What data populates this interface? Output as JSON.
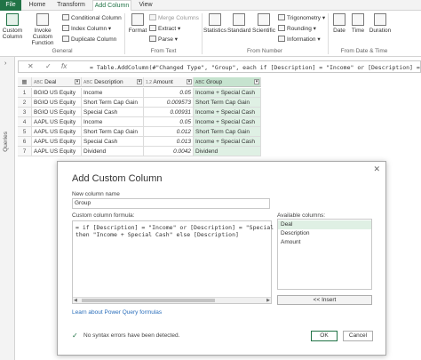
{
  "ribbon": {
    "tabs": [
      "File",
      "Home",
      "Transform",
      "Add Column",
      "View"
    ],
    "active_tab": "Add Column",
    "groups": {
      "general": {
        "label": "General",
        "custom_column": "Custom Column",
        "invoke_custom_function": "Invoke Custom Function",
        "conditional_column": "Conditional Column",
        "index_column": "Index Column",
        "duplicate_column": "Duplicate Column"
      },
      "from_text": {
        "label": "From Text",
        "format": "Format",
        "merge_columns": "Merge Columns",
        "extract": "Extract",
        "parse": "Parse"
      },
      "from_number": {
        "label": "From Number",
        "statistics": "Statistics",
        "standard": "Standard",
        "scientific": "Scientific",
        "trigonometry": "Trigonometry",
        "rounding": "Rounding",
        "information": "Information"
      },
      "from_date_time": {
        "label": "From Date & Time",
        "date": "Date",
        "time": "Time",
        "duration": "Duration"
      }
    }
  },
  "queries_pane": {
    "label": "Queries"
  },
  "formula_bar": {
    "cancel": "✕",
    "confirm": "✓",
    "fx": "fx",
    "text": "= Table.AddColumn(#\"Changed Type\", \"Group\", each if [Description] = \"Income\" or [Description] = \"Special Cash\""
  },
  "grid": {
    "headers": [
      "Deal",
      "Description",
      "Amount",
      "Group"
    ],
    "header_types": [
      "ABC",
      "ABC",
      "1.2",
      "ABC"
    ],
    "rows": [
      {
        "n": "1",
        "deal": "BGIO US Equity",
        "desc": "Income",
        "amount": "0.05",
        "group": "Income + Special Cash"
      },
      {
        "n": "2",
        "deal": "BGIO US Equity",
        "desc": "Short Term Cap Gain",
        "amount": "0.009573",
        "group": "Short Term Cap Gain"
      },
      {
        "n": "3",
        "deal": "BGIO US Equity",
        "desc": "Special Cash",
        "amount": "0.00931",
        "group": "Income + Special Cash"
      },
      {
        "n": "4",
        "deal": "AAPL US Equity",
        "desc": "Income",
        "amount": "0.05",
        "group": "Income + Special Cash"
      },
      {
        "n": "5",
        "deal": "AAPL US Equity",
        "desc": "Short Term Cap Gain",
        "amount": "0.012",
        "group": "Short Term Cap Gain"
      },
      {
        "n": "6",
        "deal": "AAPL US Equity",
        "desc": "Special Cash",
        "amount": "0.013",
        "group": "Income + Special Cash"
      },
      {
        "n": "7",
        "deal": "AAPL US Equity",
        "desc": "Dividend",
        "amount": "0.0042",
        "group": "Dividend"
      }
    ]
  },
  "dialog": {
    "title": "Add Custom Column",
    "close": "✕",
    "new_column_label": "New column name",
    "new_column_value": "Group",
    "formula_label": "Custom column formula:",
    "formula": "= if [Description] = \"Income\" or [Description] = \"Special Cash\"\nthen \"Income + Special Cash\" else [Description]",
    "available_label": "Available columns:",
    "available_columns": [
      "Deal",
      "Description",
      "Amount"
    ],
    "selected_available": "Deal",
    "insert_button": "<< Insert",
    "learn_link": "Learn about Power Query formulas",
    "status": "No syntax errors have been detected.",
    "ok_button": "OK",
    "cancel_button": "Cancel"
  },
  "colors": {
    "accent": "#217346",
    "group_fill": "#dff0e4",
    "link": "#2a6ebb"
  }
}
